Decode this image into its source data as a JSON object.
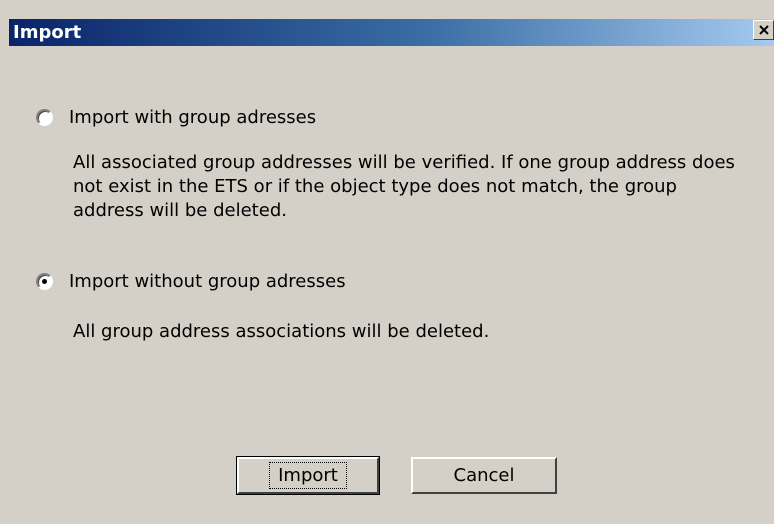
{
  "window": {
    "title": "Import",
    "close_symbol": "close-icon"
  },
  "options": [
    {
      "label": "Import with group adresses",
      "selected": false,
      "description": "All associated group addresses will be verified. If one group address does not exist in the ETS or if the object type does not match, the group address will be deleted."
    },
    {
      "label": "Import without group adresses",
      "selected": true,
      "description": "All group address associations will be deleted."
    }
  ],
  "buttons": {
    "import_label": "Import",
    "cancel_label": "Cancel"
  }
}
